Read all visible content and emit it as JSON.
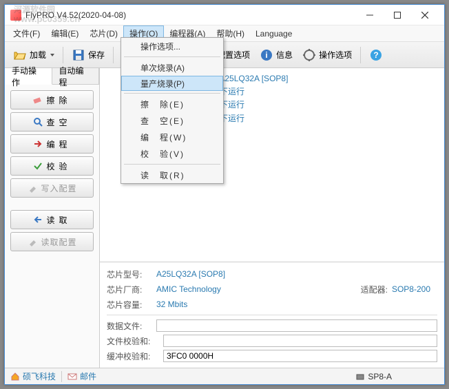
{
  "watermark": {
    "line1": "河源软件园",
    "line2": "www.pc0359.cn"
  },
  "title": "FlyPRO V4.52(2020-04-08)",
  "menu": {
    "file": "文件(F)",
    "edit": "编辑(E)",
    "chip": "芯片(D)",
    "operate": "操作(O)",
    "programmer": "编程器(A)",
    "help": "帮助(H)",
    "language": "Language"
  },
  "toolbar": {
    "load": "加载",
    "save": "保存",
    "config": "配置选项",
    "info": "信息",
    "options": "操作选项"
  },
  "dropdown": {
    "options": "操作选项...",
    "single": "单次烧录(A)",
    "mass": "量产烧录(P)",
    "erase_e": "擦　除(E)",
    "blank_e": "查　空(E)",
    "program_w": "编　程(W)",
    "verify_v": "校　验(V)",
    "read_r": "读　取(R)"
  },
  "tabs": {
    "manual": "手动操作",
    "auto": "自动编程"
  },
  "ops": {
    "erase": "擦除",
    "blank": "查空",
    "program": "编程",
    "verify": "校验",
    "writecfg": "写入配置",
    "read": "读取",
    "readcfg": "读取配置"
  },
  "log": {
    "l1_link": "A25LQ32A [SOP8]",
    "l2": ")下运行",
    "l3": ")下运行",
    "l4": ")下运行"
  },
  "info": {
    "model_label": "芯片型号:",
    "model_val": "A25LQ32A [SOP8]",
    "vendor_label": "芯片厂商:",
    "vendor_val": "AMIC Technology",
    "capacity_label": "芯片容量:",
    "capacity_val": "32 Mbits",
    "adapter_label": "适配器:",
    "adapter_val": "SOP8-200",
    "datafile_label": "数据文件:",
    "datafile_val": "",
    "filecheck_label": "文件校验和:",
    "filecheck_val": "",
    "bufcheck_label": "缓冲校验和:",
    "bufcheck_val": "3FC0 0000H"
  },
  "status": {
    "company": "硕飞科技",
    "mail": "邮件",
    "programmer": "SP8-A"
  }
}
